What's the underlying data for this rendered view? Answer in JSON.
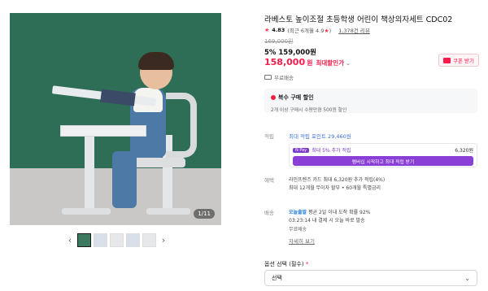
{
  "gallery": {
    "counter": "1/11",
    "prev_icon": "chevron-left-icon",
    "next_icon": "chevron-right-icon",
    "thumb_count": 5
  },
  "product": {
    "title": "라베스토 높이조절 초등학생 어린이 책상의자세트 CDC02",
    "rating": {
      "icon": "star-icon",
      "score": "4.83",
      "recent": "(최근 6개월 4.9",
      "recent_star": "★",
      "recent_close": ")",
      "reviews": "1,378건 리뷰"
    },
    "original_price": "169,000원",
    "discount_line": "5% 159,000원",
    "sale_price": "158,000",
    "sale_unit": "원",
    "sale_label": "최대할인가",
    "coupon_label": "쿠폰 받기",
    "shipping_top": "무료배송"
  },
  "multi_purchase": {
    "title": "복수 구매 할인",
    "subtitle": "2개 이상 구매시 수량만큼 500원 할인"
  },
  "points": {
    "label": "적립",
    "max_points": "최대 적립 포인트 29,460원",
    "extra_badge": "N Pay",
    "extra_text": "최대 5% 추가 적립",
    "extra_amount": "6,320원",
    "button": "멤버십 시작하고 최대 적립 받기"
  },
  "card": {
    "label": "혜택",
    "line1": "라인프렌즈 카드 최대 6,320원 추가 적립(4%)",
    "line2": "최대 12개월 무이자 할부 • 60개월 특별금리"
  },
  "delivery": {
    "label": "배송",
    "tag": "오늘출발",
    "line1_rest": " 평균 2일 이내 도착 확률 92%",
    "line2": "03:23:14 내 결제 시 오늘 바로 발송",
    "line3": "무료배송",
    "more": "자세히 보기"
  },
  "options": {
    "label": "옵션 선택",
    "required": "(필수)",
    "required_mark": "*",
    "select_value": "선택"
  },
  "colors": {
    "accent_red": "#ff1a4a",
    "purple": "#8a3fd6",
    "blue": "#3d6fd9"
  }
}
